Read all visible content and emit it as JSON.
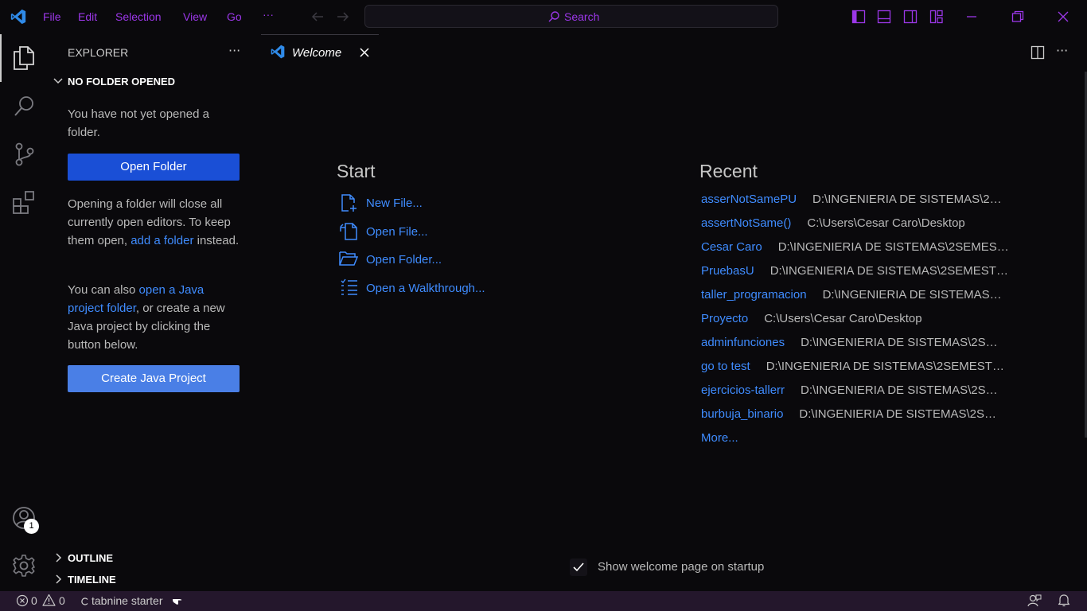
{
  "menu": [
    "File",
    "Edit",
    "Selection",
    "View",
    "Go"
  ],
  "menu_more": "···",
  "search": {
    "label": "Search"
  },
  "explorer": {
    "title": "EXPLORER",
    "more": "···",
    "section": "NO FOLDER OPENED",
    "msg1": "You have not yet opened a folder.",
    "open_folder_btn": "Open Folder",
    "msg2_a": "Opening a folder will close all currently open editors. To keep them open, ",
    "msg2_link": "add a folder",
    "msg2_b": " instead.",
    "msg3_a": "You can also ",
    "msg3_link": "open a Java project folder",
    "msg3_b": ", or create a new Java project by clicking the button below.",
    "create_java_btn": "Create Java Project",
    "outline": "OUTLINE",
    "timeline": "TIMELINE"
  },
  "tab": {
    "label": "Welcome"
  },
  "welcome": {
    "start_heading": "Start",
    "start_links": [
      "New File...",
      "Open File...",
      "Open Folder...",
      "Open a Walkthrough..."
    ],
    "recent_heading": "Recent",
    "recent": [
      {
        "name": "asserNotSamePU",
        "path": "D:\\INGENIERIA DE SISTEMAS\\2SE..."
      },
      {
        "name": "assertNotSame()",
        "path": "C:\\Users\\Cesar Caro\\Desktop"
      },
      {
        "name": "Cesar Caro",
        "path": "D:\\INGENIERIA DE SISTEMAS\\2SEMEST..."
      },
      {
        "name": "PruebasU",
        "path": "D:\\INGENIERIA DE SISTEMAS\\2SEMESTR..."
      },
      {
        "name": "taller_programacion",
        "path": "D:\\INGENIERIA DE SISTEMAS\\..."
      },
      {
        "name": "Proyecto",
        "path": "C:\\Users\\Cesar Caro\\Desktop"
      },
      {
        "name": "adminfunciones",
        "path": "D:\\INGENIERIA DE SISTEMAS\\2SE..."
      },
      {
        "name": "go to test",
        "path": "D:\\INGENIERIA DE SISTEMAS\\2SEMESTR..."
      },
      {
        "name": "ejercicios-tallerr",
        "path": "D:\\INGENIERIA DE SISTEMAS\\2SE..."
      },
      {
        "name": "burbuja_binario",
        "path": "D:\\INGENIERIA DE SISTEMAS\\2SE..."
      }
    ],
    "more": "More...",
    "show_on_startup": "Show welcome page on startup"
  },
  "accounts_badge": "1",
  "status": {
    "errors": "0",
    "warnings": "0",
    "tabnine": "tabnine starter"
  },
  "colors": {
    "accent": "#9b37e8",
    "link": "#3f8cff",
    "button": "#1a4fd6",
    "status_bar": "#24172c"
  }
}
